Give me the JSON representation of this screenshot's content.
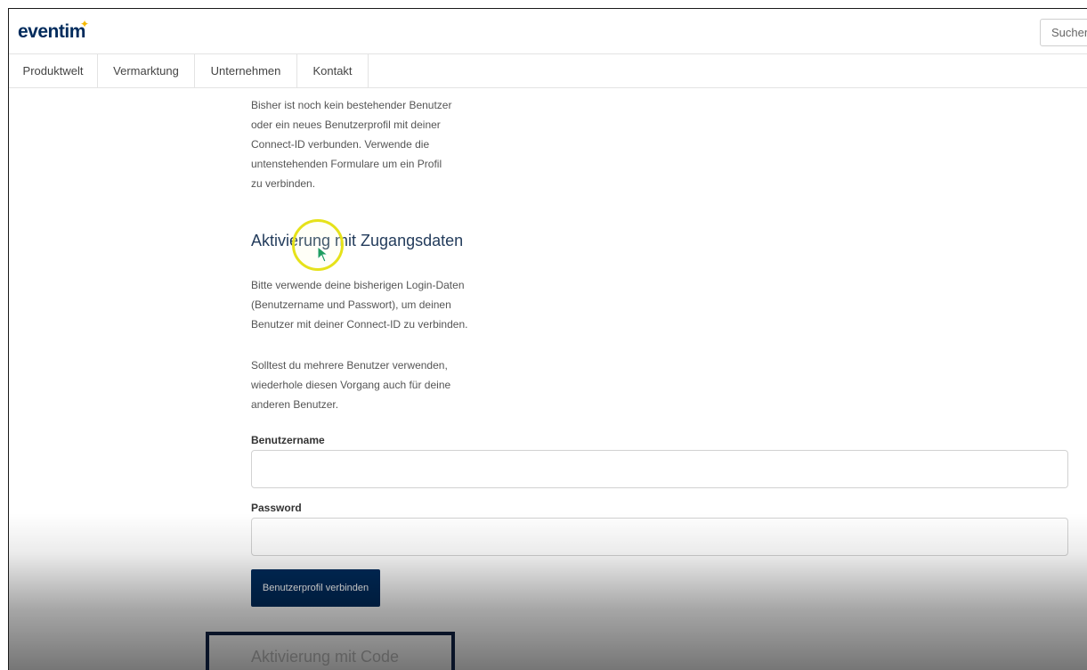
{
  "header": {
    "logo": "eventim",
    "logo_star": "✦",
    "search_placeholder": "Suchen"
  },
  "nav": {
    "items": [
      "Produktwelt",
      "Vermarktung",
      "Unternehmen",
      "Kontakt"
    ]
  },
  "intro": {
    "lines": [
      "Bisher ist noch kein bestehender Benutzer",
      "oder ein neues Benutzerprofil mit deiner",
      "Connect-ID verbunden. Verwende die",
      "untenstehenden Formulare um ein Profil",
      "zu verbinden."
    ]
  },
  "section1": {
    "heading": "Aktivierung mit Zugangsdaten",
    "para1": [
      "Bitte verwende deine bisherigen Login-Daten",
      "(Benutzername und Passwort), um deinen",
      "Benutzer mit deiner Connect-ID zu verbinden."
    ],
    "para2": [
      "Solltest du mehrere Benutzer verwenden,",
      "wiederhole diesen Vorgang auch für deine",
      "anderen Benutzer."
    ],
    "username_label": "Benutzername",
    "username_value": "",
    "password_label": "Password",
    "password_value": "",
    "submit_label": "Benutzerprofil verbinden"
  },
  "section2": {
    "heading": "Aktivierung mit Code"
  },
  "colors": {
    "brand": "#002b5c",
    "accent": "#f5b800",
    "cursor_highlight": "#e6e21a"
  }
}
